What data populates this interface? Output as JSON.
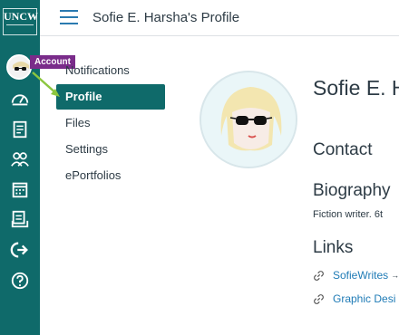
{
  "global_nav": {
    "logo_text": "UNCW",
    "account_tooltip": "Account",
    "icons": [
      "account-avatar-icon",
      "dashboard-icon",
      "courses-icon",
      "groups-icon",
      "calendar-icon",
      "inbox-icon",
      "commons-icon",
      "help-icon"
    ],
    "bg_color": "#0f6a6a"
  },
  "header": {
    "title": "Sofie E. Harsha's Profile"
  },
  "sub_nav": {
    "items": [
      {
        "label": "Notifications",
        "active": false
      },
      {
        "label": "Profile",
        "active": true
      },
      {
        "label": "Files",
        "active": false
      },
      {
        "label": "Settings",
        "active": false
      },
      {
        "label": "ePortfolios",
        "active": false
      }
    ]
  },
  "profile": {
    "name": "Sofie E. H",
    "contact_heading": "Contact",
    "biography_heading": "Biography",
    "biography_text": "Fiction writer. 6t",
    "links_heading": "Links",
    "links": [
      {
        "label": "SofieWrites",
        "suffix": "→"
      },
      {
        "label": "Graphic Desi",
        "suffix": ""
      }
    ]
  },
  "colors": {
    "accent": "#0f6a6a",
    "tooltip": "#7a2c8a",
    "link": "#1f7bb6",
    "annotation_arrow": "#8cc63f"
  }
}
